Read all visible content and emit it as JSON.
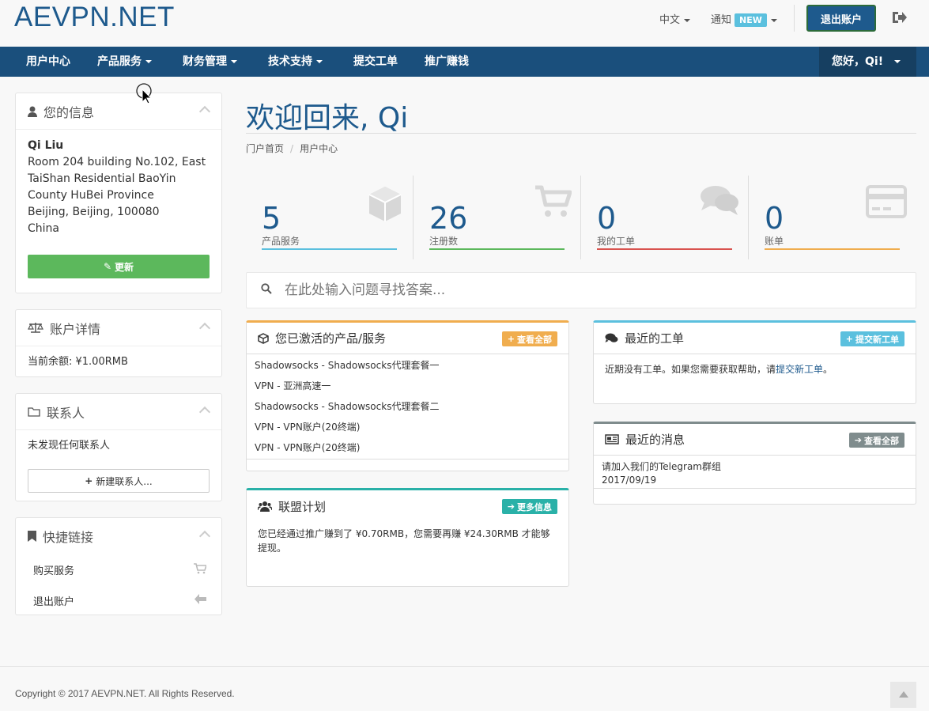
{
  "header": {
    "logo": "AEVPN.NET",
    "language": "中文",
    "notify_label": "通知",
    "notify_badge": "NEW",
    "logout_button": "退出账户"
  },
  "nav": {
    "items": [
      {
        "label": "用户中心",
        "dropdown": false
      },
      {
        "label": "产品服务",
        "dropdown": true
      },
      {
        "label": "财务管理",
        "dropdown": true
      },
      {
        "label": "技术支持",
        "dropdown": true
      },
      {
        "label": "提交工单",
        "dropdown": false
      },
      {
        "label": "推广赚钱",
        "dropdown": false
      }
    ],
    "greeting": "您好，Qi!"
  },
  "sidebar": {
    "your_info": {
      "title": "您的信息",
      "name": "Qi Liu",
      "address_lines": [
        "Room 204 building No.102, East",
        "TaiShan Residential BaoYin",
        "County HuBei Province",
        "Beijing, Beijing, 100080",
        "China"
      ],
      "update_button": "更新"
    },
    "account": {
      "title": "账户详情",
      "balance": "当前余额: ¥1.00RMB"
    },
    "contacts": {
      "title": "联系人",
      "empty": "未发现任何联系人",
      "new_button": "新建联系人..."
    },
    "quick_links": {
      "title": "快捷链接",
      "items": [
        {
          "label": "购买服务",
          "icon": "cart-icon"
        },
        {
          "label": "退出账户",
          "icon": "arrow-left-icon"
        }
      ]
    }
  },
  "main": {
    "welcome": "欢迎回来, Qi",
    "breadcrumb": [
      "门户首页",
      "用户中心"
    ],
    "stats": [
      {
        "value": "5",
        "label": "产品服务",
        "color": "#5bc0de",
        "icon": "cube-icon"
      },
      {
        "value": "26",
        "label": "注册数",
        "color": "#5cb85c",
        "icon": "cart-icon"
      },
      {
        "value": "0",
        "label": "我的工单",
        "color": "#d9534f",
        "icon": "comments-icon"
      },
      {
        "value": "0",
        "label": "账单",
        "color": "#f0ad4e",
        "icon": "credit-card-icon"
      }
    ],
    "search_placeholder": "在此处输入问题寻找答案...",
    "services": {
      "title": "您已激活的产品/服务",
      "button": "查看全部",
      "accent": "#f0ad4e",
      "items": [
        "Shadowsocks - Shadowsocks代理套餐一",
        "VPN - 亚洲高速一",
        "Shadowsocks - Shadowsocks代理套餐二",
        "VPN - VPN账户(20终端)",
        "VPN - VPN账户(20终端)"
      ]
    },
    "affiliate": {
      "title": "联盟计划",
      "button": "更多信息",
      "accent": "#2ab1a8",
      "text": "您已经通过推广赚到了 ¥0.70RMB，您需要再赚 ¥24.30RMB 才能够提现。"
    },
    "tickets": {
      "title": "最近的工单",
      "button": "提交新工单",
      "accent": "#5bc0de",
      "text_before": "近期没有工单。如果您需要获取帮助，请",
      "link": "提交新工单",
      "text_after": "。"
    },
    "news": {
      "title": "最近的消息",
      "button": "查看全部",
      "accent": "#7f8c8d",
      "item_title": "请加入我们的Telegram群组",
      "item_date": "2017/09/19"
    }
  },
  "footer": {
    "copyright": "Copyright © 2017 AEVPN.NET. All Rights Reserved."
  }
}
